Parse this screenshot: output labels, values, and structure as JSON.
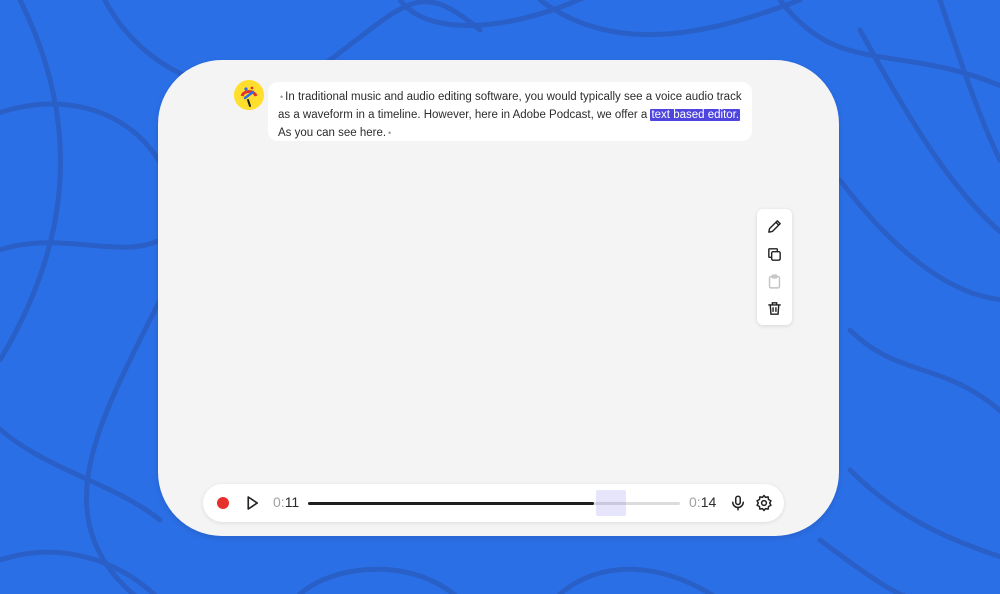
{
  "colors": {
    "background": "#2b6fe6",
    "highlight": "#4e45df",
    "record": "#e5302c"
  },
  "transcript": {
    "text_before": "In traditional music and audio editing software, you would typically see a voice audio track as a waveform in a timeline. However, here in Adobe Podcast, we offer a ",
    "highlighted": "text based editor.",
    "text_after": " As you can see here.",
    "marker": "•"
  },
  "toolbar": {
    "icons": [
      "pencil-icon",
      "copy-icon",
      "paste-icon",
      "trash-icon"
    ]
  },
  "player": {
    "current_time": {
      "prefix": "0:",
      "value": "11"
    },
    "total_time": {
      "prefix": "0:",
      "value": "14"
    },
    "progress": 0.77,
    "selection": {
      "start": 0.775,
      "end": 0.855
    },
    "icons": [
      "record-icon",
      "play-icon",
      "microphone-icon",
      "gear-icon"
    ]
  }
}
